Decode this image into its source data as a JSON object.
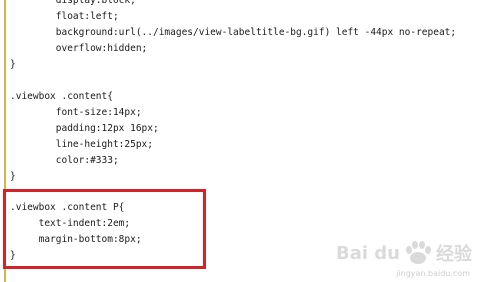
{
  "code_lines": [
    "        display:block;",
    "        float:left;",
    "        background:url(../images/view-labeltitle-bg.gif) left -44px no-repeat;",
    "        overflow:hidden;",
    "}",
    "",
    ".viewbox .content{",
    "        font-size:14px;",
    "        padding:12px 16px;",
    "        line-height:25px;",
    "        color:#333;",
    "}",
    "",
    ".viewbox .content P{",
    "     text-indent:2em;",
    "     margin-bottom:8px;",
    "}"
  ],
  "watermark": {
    "brand": "Bai du",
    "jingyan": "经验",
    "url": "jingyan.baidu.com"
  },
  "colors": {
    "highlight_border": "#d2232a",
    "gutter": "#d8b24a"
  }
}
